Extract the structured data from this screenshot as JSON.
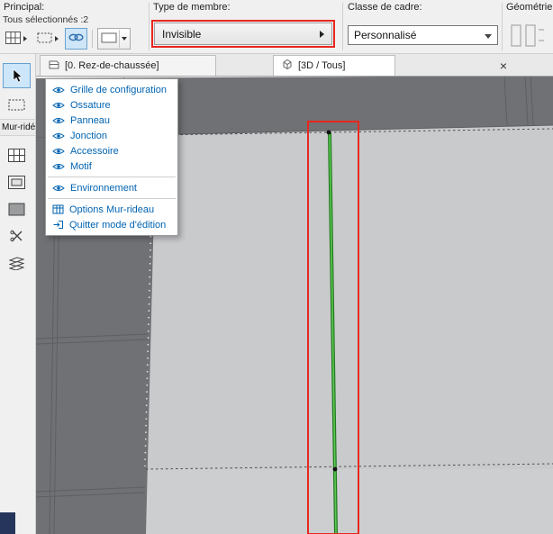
{
  "toolbar": {
    "principal_label": "Principal:",
    "selection_status": "Tous sélectionnés :2",
    "member_type_label": "Type de membre:",
    "member_type_value": "Invisible",
    "frame_class_label": "Classe de cadre:",
    "frame_class_value": "Personnalisé",
    "geometry_label": "Géométrie d"
  },
  "tabbar": {
    "tabs": [
      {
        "label": "[0. Rez-de-chaussée]"
      },
      {
        "label": "[3D / Tous]"
      }
    ],
    "close_label": "×"
  },
  "sidebar": {
    "panel_title": "Mur-ridé"
  },
  "edit_menu": {
    "items": [
      {
        "label": "Grille de configuration",
        "icon": "eye-icon"
      },
      {
        "label": "Ossature",
        "icon": "eye-icon"
      },
      {
        "label": "Panneau",
        "icon": "eye-icon"
      },
      {
        "label": "Jonction",
        "icon": "eye-icon"
      },
      {
        "label": "Accessoire",
        "icon": "eye-icon"
      },
      {
        "label": "Motif",
        "icon": "eye-icon"
      },
      {
        "label": "Environnement",
        "icon": "eye-icon"
      },
      {
        "label": "Options Mur-rideau",
        "icon": "grid-options-icon"
      },
      {
        "label": "Quitter mode d'édition",
        "icon": "exit-icon"
      }
    ]
  },
  "colors": {
    "annotation_red": "#e8271f",
    "mullion_green": "#5ec653",
    "mullion_green_dark": "#1f7a1f",
    "wall_dark": "#6f7174",
    "wall_light": "#c9cacc",
    "menu_link_blue": "#0063b1"
  }
}
